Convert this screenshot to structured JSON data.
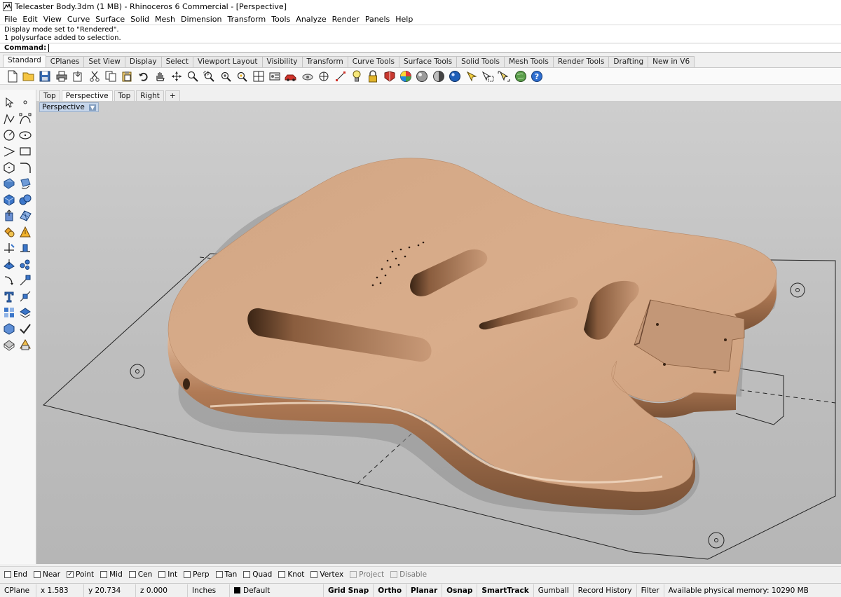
{
  "window": {
    "title": "Telecaster Body.3dm (1 MB) - Rhinoceros 6 Commercial - [Perspective]"
  },
  "menu": [
    "File",
    "Edit",
    "View",
    "Curve",
    "Surface",
    "Solid",
    "Mesh",
    "Dimension",
    "Transform",
    "Tools",
    "Analyze",
    "Render",
    "Panels",
    "Help"
  ],
  "command_history": [
    "Display mode set to \"Rendered\".",
    "1 polysurface added to selection."
  ],
  "command_prompt": {
    "label": "Command:",
    "value": ""
  },
  "toolbar_tabs": {
    "items": [
      "Standard",
      "CPlanes",
      "Set View",
      "Display",
      "Select",
      "Viewport Layout",
      "Visibility",
      "Transform",
      "Curve Tools",
      "Surface Tools",
      "Solid Tools",
      "Mesh Tools",
      "Render Tools",
      "Drafting",
      "New in V6"
    ],
    "active": "Standard"
  },
  "standard_toolbar_icons": [
    "new-file-icon",
    "open-folder-icon",
    "save-icon",
    "print-icon",
    "import-icon",
    "cut-icon",
    "copy-icon",
    "paste-icon",
    "undo-icon",
    "pan-hand-icon",
    "rotate-view-icon",
    "zoom-icon",
    "zoom-window-icon",
    "zoom-extents-icon",
    "zoom-selected-icon",
    "four-view-icon",
    "options-icon",
    "car-icon",
    "named-view-icon",
    "target-icon",
    "grip-icon",
    "lightbulb-icon",
    "lock-icon",
    "material-icon",
    "color-wheel-icon",
    "render-sphere-icon",
    "render-preview-icon",
    "rendered-sphere-icon",
    "highlight-icon",
    "select-icon",
    "select-all-icon",
    "globe-icon",
    "help-icon"
  ],
  "sidebar_icons": [
    "select-arrow-icon",
    "point-icon",
    "polyline-icon",
    "curve-cp-icon",
    "circle-icon",
    "ellipse-icon",
    "arc-icon",
    "rectangle-icon",
    "polygon-icon",
    "fillet-icon",
    "surface-icon",
    "rotate-surface-icon",
    "box-icon",
    "sphere-icon",
    "extrude-icon",
    "mesh-icon",
    "boolean-icon",
    "explode-icon",
    "trim-icon",
    "split-icon",
    "move-icon",
    "scale-icon",
    "rotate-icon",
    "array-icon",
    "text-icon",
    "dimension-icon",
    "grid-icon",
    "layer-icon",
    "block-icon",
    "check-icon",
    "render-icon",
    "light-icon"
  ],
  "viewport_tabs": {
    "items": [
      "Top",
      "Perspective",
      "Top",
      "Right"
    ],
    "active_index": 1,
    "add_label": "+"
  },
  "viewport": {
    "name": "Perspective",
    "display_mode": "Rendered"
  },
  "osnaps": [
    {
      "label": "End",
      "checked": false,
      "enabled": true
    },
    {
      "label": "Near",
      "checked": false,
      "enabled": true
    },
    {
      "label": "Point",
      "checked": true,
      "enabled": true
    },
    {
      "label": "Mid",
      "checked": false,
      "enabled": true
    },
    {
      "label": "Cen",
      "checked": false,
      "enabled": true
    },
    {
      "label": "Int",
      "checked": false,
      "enabled": true
    },
    {
      "label": "Perp",
      "checked": false,
      "enabled": true
    },
    {
      "label": "Tan",
      "checked": false,
      "enabled": true
    },
    {
      "label": "Quad",
      "checked": false,
      "enabled": true
    },
    {
      "label": "Knot",
      "checked": false,
      "enabled": true
    },
    {
      "label": "Vertex",
      "checked": false,
      "enabled": true
    },
    {
      "label": "Project",
      "checked": false,
      "enabled": false
    },
    {
      "label": "Disable",
      "checked": false,
      "enabled": false
    }
  ],
  "status": {
    "cplane": "CPlane",
    "x": "x 1.583",
    "y": "y 20.734",
    "z": "z 0.000",
    "units": "Inches",
    "layer": "Default",
    "layer_color": "#000000",
    "panes": [
      "Grid Snap",
      "Ortho",
      "Planar",
      "Osnap",
      "SmartTrack",
      "Gumball",
      "Record History",
      "Filter"
    ],
    "memory": "Available physical memory: 10290 MB"
  },
  "colors": {
    "wood": "#d6a886",
    "viewport_bg": "#c2c2c2",
    "active_viewport_label": "#c5d5ea"
  }
}
